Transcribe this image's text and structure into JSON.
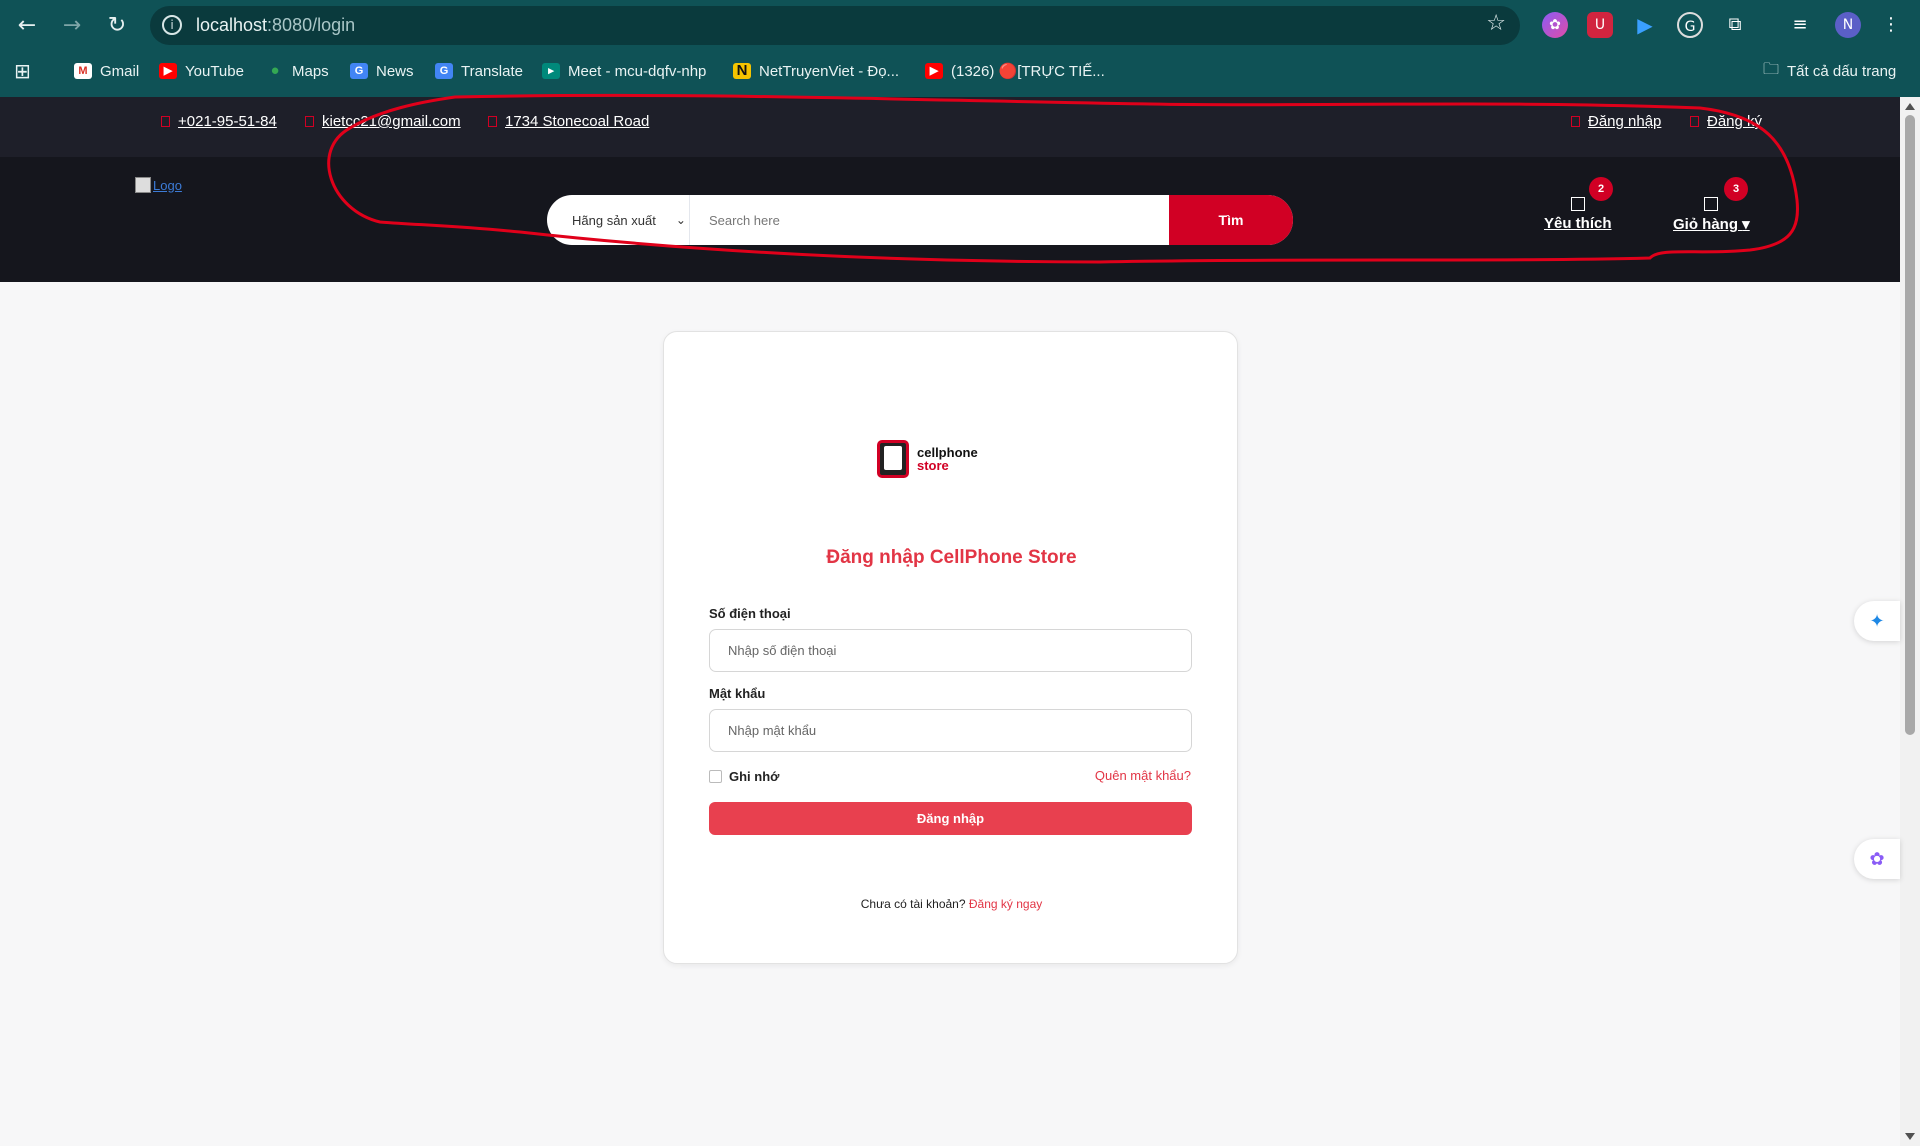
{
  "browser": {
    "url_host": "localhost",
    "url_path": ":8080/login",
    "bookmarks": [
      {
        "label": "Gmail"
      },
      {
        "label": "YouTube"
      },
      {
        "label": "Maps"
      },
      {
        "label": "News"
      },
      {
        "label": "Translate"
      },
      {
        "label": "Meet - mcu-dqfv-nhp"
      },
      {
        "label": "NetTruyenViet - Đọ..."
      },
      {
        "label": "(1326) 🔴[TRỰC TIẾ..."
      }
    ],
    "all_bookmarks": "Tất cả dấu trang",
    "profile_initial": "N"
  },
  "topbar": {
    "phone": "+021-95-51-84",
    "email": "kietcc21@gmail.com",
    "address": "1734 Stonecoal Road",
    "login": "Đăng nhập",
    "register": "Đăng ký"
  },
  "header": {
    "logo_alt": "Logo",
    "category_select": "Hãng sản xuất",
    "search_placeholder": "Search here",
    "search_button": "Tìm",
    "wishlist_label": "Yêu thích",
    "wishlist_count": "2",
    "cart_label": "Giỏ hàng",
    "cart_count": "3"
  },
  "login": {
    "brand_line1": "cellphone",
    "brand_line2": "store",
    "title": "Đăng nhập CellPhone Store",
    "phone_label": "Số điện thoại",
    "phone_placeholder": "Nhập số điện thoại",
    "password_label": "Mật khẩu",
    "password_placeholder": "Nhập mật khẩu",
    "remember": "Ghi nhớ",
    "forgot": "Quên mật khẩu?",
    "submit": "Đăng nhập",
    "no_account": "Chưa có tài khoản?",
    "register_now": "Đăng ký ngay"
  },
  "colors": {
    "chrome": "#0f5256",
    "topbar": "#1e1f29",
    "header": "#15161d",
    "accent": "#d10024",
    "button": "#e8404f",
    "annotation": "#e0001a"
  }
}
